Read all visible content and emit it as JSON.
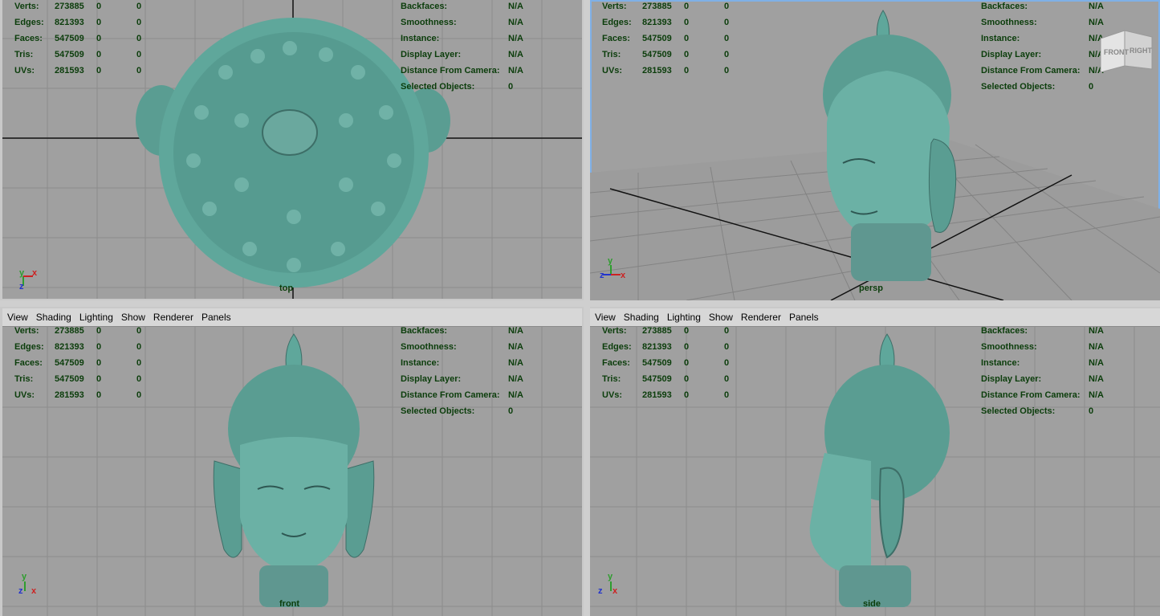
{
  "menu": [
    "View",
    "Shading",
    "Lighting",
    "Show",
    "Renderer",
    "Panels"
  ],
  "hud_left": [
    {
      "label": "Verts:",
      "a": "273885",
      "b": "0",
      "c": "0"
    },
    {
      "label": "Edges:",
      "a": "821393",
      "b": "0",
      "c": "0"
    },
    {
      "label": "Faces:",
      "a": "547509",
      "b": "0",
      "c": "0"
    },
    {
      "label": "Tris:",
      "a": "547509",
      "b": "0",
      "c": "0"
    },
    {
      "label": "UVs:",
      "a": "281593",
      "b": "0",
      "c": "0"
    }
  ],
  "hud_right": [
    {
      "label": "Backfaces:",
      "value": "N/A"
    },
    {
      "label": "Smoothness:",
      "value": "N/A"
    },
    {
      "label": "Instance:",
      "value": "N/A"
    },
    {
      "label": "Display Layer:",
      "value": "N/A"
    },
    {
      "label": "Distance From Camera:",
      "value": "N/A"
    },
    {
      "label": "Selected Objects:",
      "value": "0"
    }
  ],
  "viewports": {
    "top": {
      "camera": "top",
      "axis": [
        "y",
        "x",
        "z"
      ]
    },
    "persp": {
      "camera": "persp",
      "axis": [
        "y",
        "z",
        "x"
      ]
    },
    "front": {
      "camera": "front",
      "axis": [
        "y",
        "z",
        "x"
      ]
    },
    "side": {
      "camera": "side",
      "axis": [
        "y",
        "z",
        "x"
      ]
    }
  },
  "viewcube": {
    "front": "FRONT",
    "right": "RIGHT"
  },
  "colors": {
    "viewport_bg": "#a0a0a0",
    "hud_text": "#0b3d0b",
    "bronze": "#5fa79b",
    "active_border": "#7fb0e6"
  }
}
